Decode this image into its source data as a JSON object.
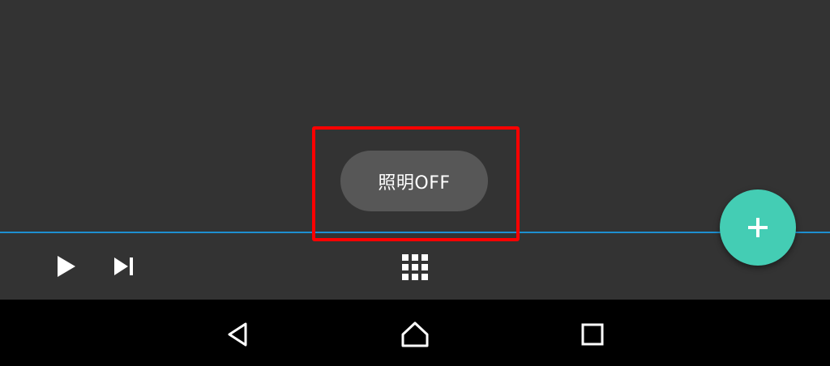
{
  "toast": {
    "text": "照明OFF"
  },
  "colors": {
    "background": "#333333",
    "divider": "#1e8fd0",
    "highlight": "#ff0000",
    "toast_bg": "#575757",
    "fab": "#44cdb4",
    "navbar": "#000000"
  },
  "toolbar": {
    "icons": [
      "play-icon",
      "skip-next-icon",
      "grid-icon"
    ]
  },
  "fab": {
    "icon": "plus-icon"
  },
  "navbar": {
    "icons": [
      "back-icon",
      "home-icon",
      "recents-icon"
    ]
  }
}
